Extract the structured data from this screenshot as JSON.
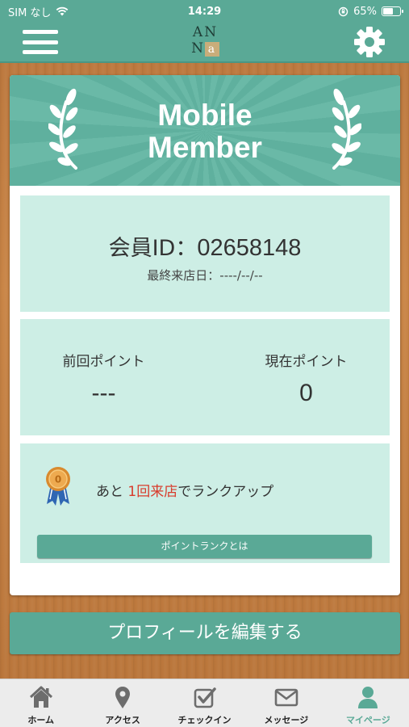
{
  "status_bar": {
    "carrier": "SIM なし",
    "time": "14:29",
    "battery_percent": "65%",
    "battery_level": 0.65
  },
  "header": {
    "logo_text": "ANNa"
  },
  "banner": {
    "title_line1": "Mobile",
    "title_line2": "Member"
  },
  "member": {
    "id_label": "会員ID：",
    "id_value": "02658148",
    "last_visit": "最終来店日：----/--/--"
  },
  "points": {
    "previous_label": "前回ポイント",
    "previous_value": "---",
    "current_label": "現在ポイント",
    "current_value": "0"
  },
  "rank": {
    "text_before": "あと ",
    "highlight": "1回来店",
    "text_after": "でランクアップ",
    "button_label": "ポイントランクとは"
  },
  "edit_profile_label": "プロフィールを編集する",
  "tabs": [
    {
      "label": "ホーム",
      "icon": "home-icon"
    },
    {
      "label": "アクセス",
      "icon": "map-pin-icon"
    },
    {
      "label": "チェックイン",
      "icon": "checkin-icon"
    },
    {
      "label": "メッセージ",
      "icon": "envelope-icon"
    },
    {
      "label": "マイページ",
      "icon": "user-icon"
    }
  ],
  "colors": {
    "accent": "#5aa996",
    "panel": "#cdeee5",
    "highlight": "#d83c2c",
    "wood": "#c98546"
  }
}
